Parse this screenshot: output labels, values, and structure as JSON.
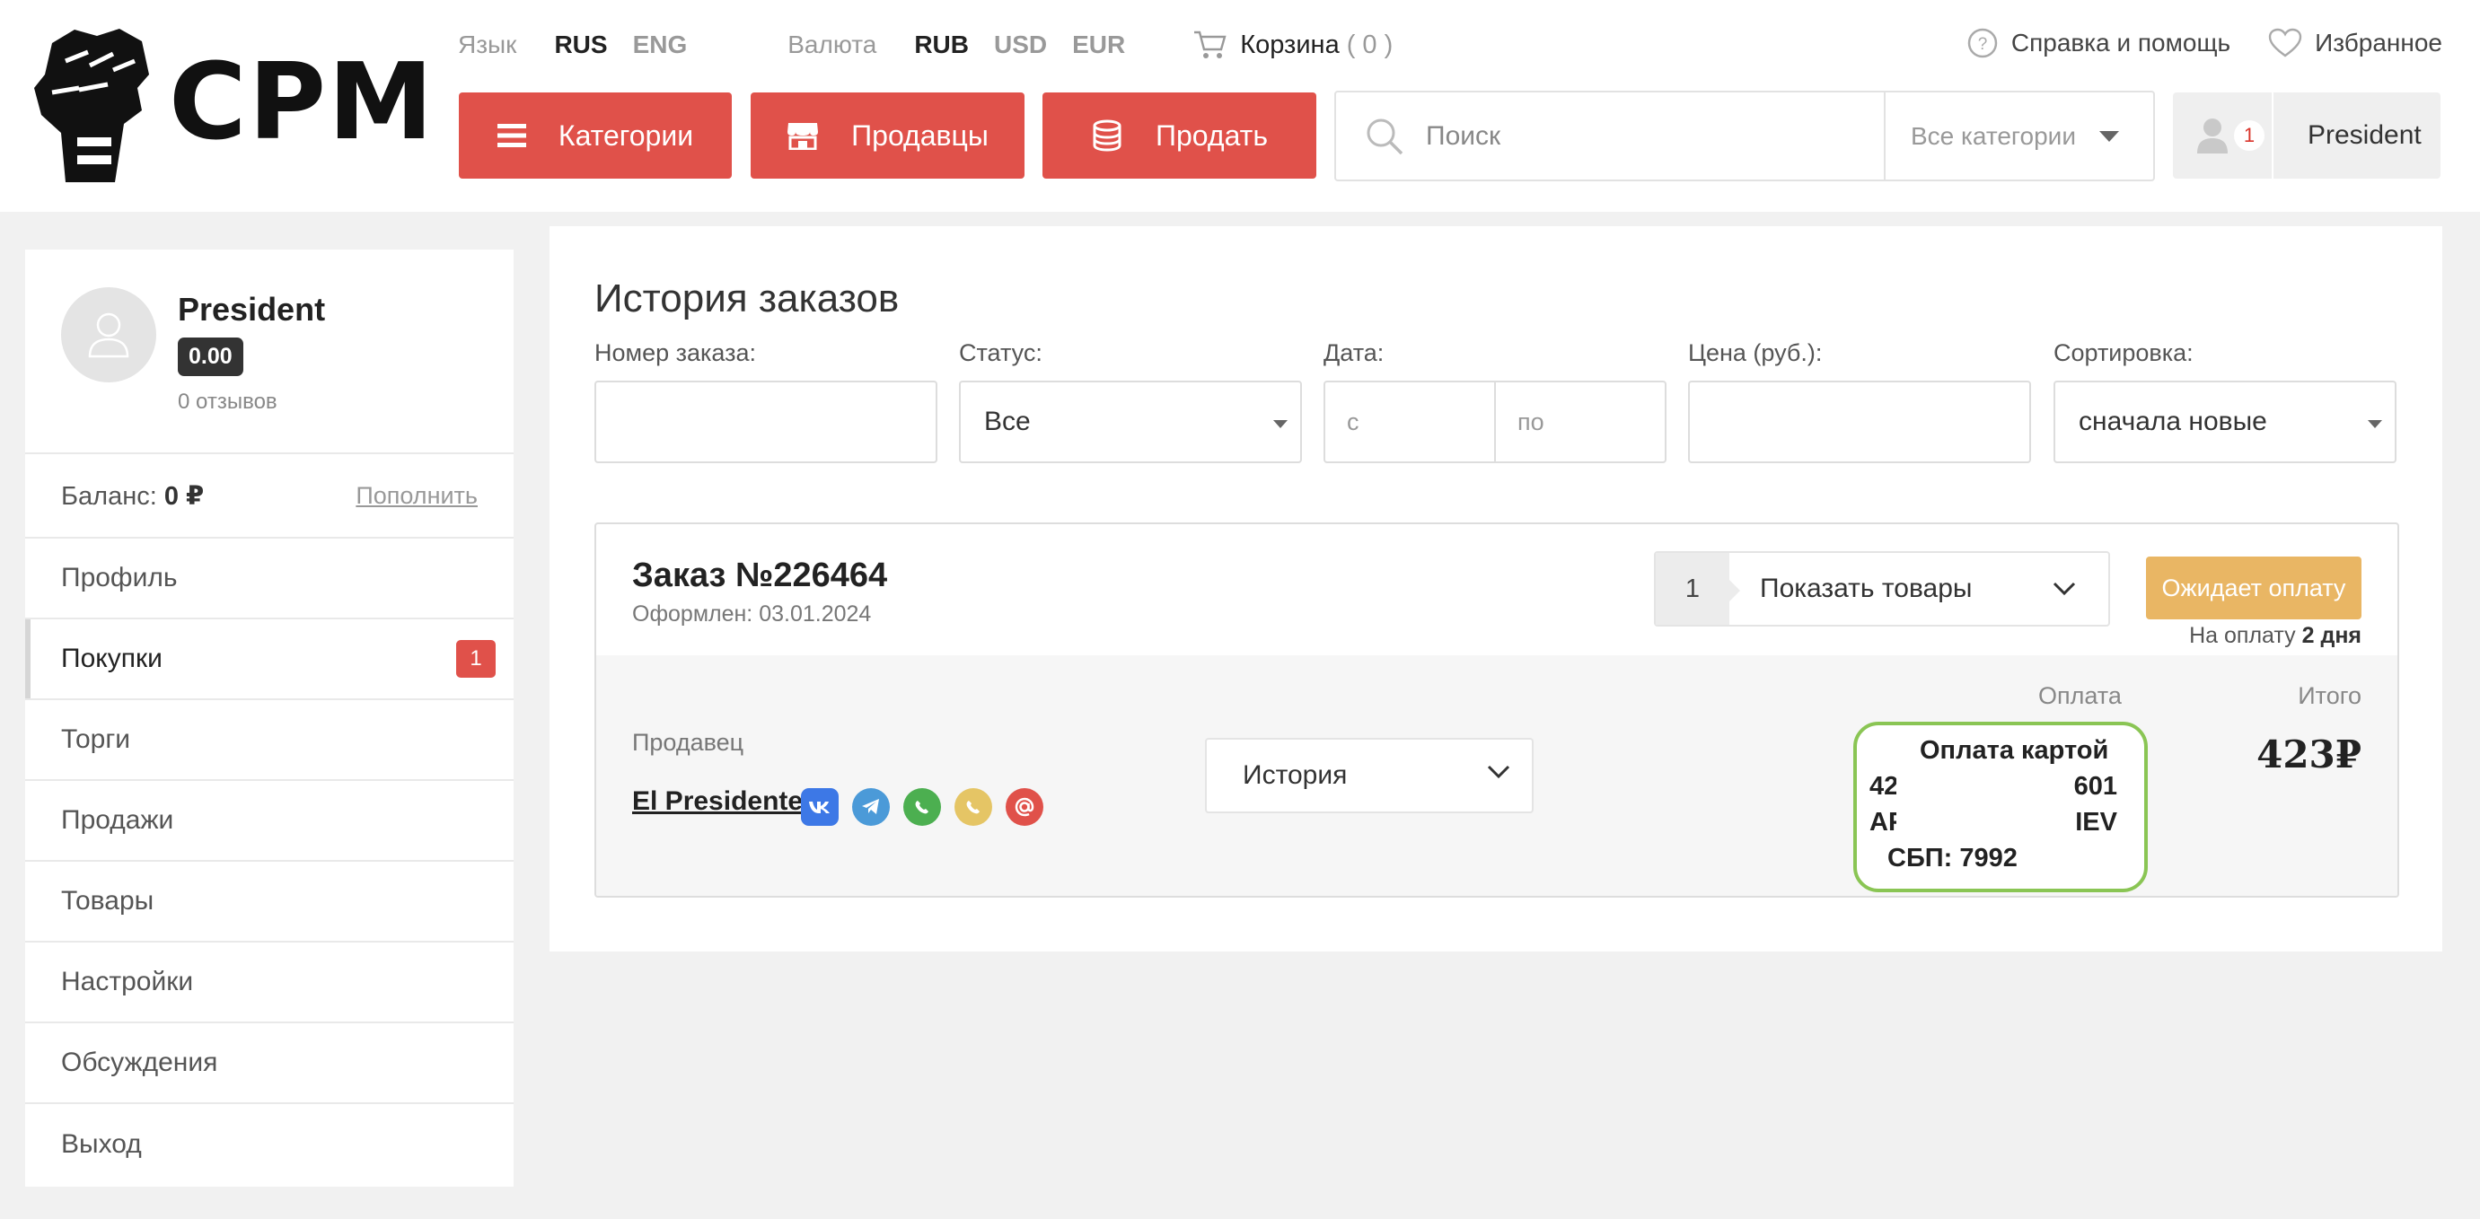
{
  "brand": {
    "name": "CPM"
  },
  "topbar": {
    "language_label": "Язык",
    "languages": [
      "RUS",
      "ENG"
    ],
    "currency_label": "Валюта",
    "currencies": [
      "RUB",
      "USD",
      "EUR"
    ],
    "cart_label": "Корзина",
    "cart_count": "( 0 )",
    "help_label": "Справка и помощь",
    "favorites_label": "Избранное"
  },
  "nav": {
    "categories_label": "Категории",
    "sellers_label": "Продавцы",
    "sell_label": "Продать"
  },
  "search": {
    "placeholder": "Поиск",
    "category": "Все категории"
  },
  "user": {
    "name": "President",
    "notifications": "1"
  },
  "sidebar": {
    "name": "President",
    "rating": "0.00",
    "reviews": "0 отзывов",
    "balance_label": "Баланс:",
    "balance_value": "0 ₽",
    "topup_label": "Пополнить",
    "items": [
      {
        "label": "Профиль"
      },
      {
        "label": "Покупки",
        "count": "1"
      },
      {
        "label": "Торги"
      },
      {
        "label": "Продажи"
      },
      {
        "label": "Товары"
      },
      {
        "label": "Настройки"
      },
      {
        "label": "Обсуждения"
      },
      {
        "label": "Выход"
      }
    ]
  },
  "main": {
    "title": "История заказов",
    "filters": {
      "order_number_label": "Номер заказа:",
      "order_number_value": "",
      "status_label": "Статус:",
      "status_value": "Все",
      "date_label": "Дата:",
      "date_from_placeholder": "с",
      "date_to_placeholder": "по",
      "price_label": "Цена (руб.):",
      "price_value": "",
      "sort_label": "Сортировка:",
      "sort_value": "сначала новые"
    },
    "order": {
      "number": "Заказ №226464",
      "date": "Оформлен: 03.01.2024",
      "goods_qty": "1",
      "show_goods_label": "Показать товары",
      "status": "Ожидает оплату",
      "pay_due_label": "На оплату",
      "pay_due_value": "2 дня",
      "seller_label": "Продавец",
      "seller_name": "El Presidente",
      "history_label": "История",
      "payment_label": "Оплата",
      "total_label": "Итого",
      "payment_line1": "Оплата картой",
      "payment_line2_start": "42",
      "payment_line2_end": "601",
      "payment_line3_start": "AF",
      "payment_line3_end": "IEV",
      "payment_line4": "СБП: 7992",
      "total": "423₽"
    }
  },
  "colors": {
    "accent_red": "#e0514a",
    "status_orange": "#e9b664",
    "payment_border_green": "#8ac554"
  }
}
